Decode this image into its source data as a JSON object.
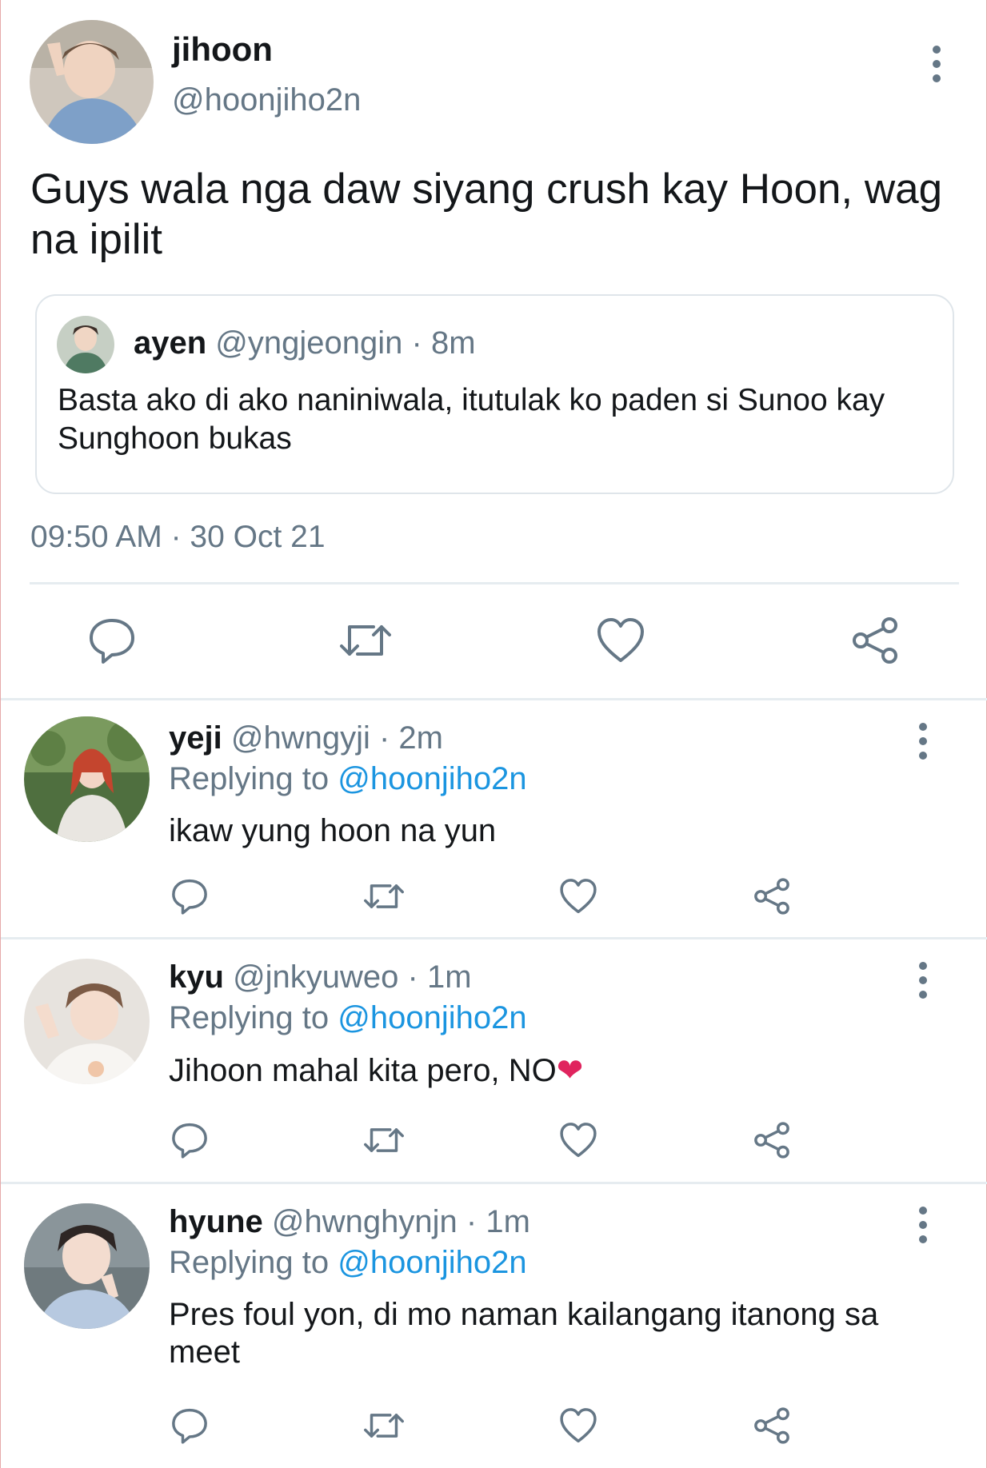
{
  "main_tweet": {
    "name": "jihoon",
    "handle": "@hoonjiho2n",
    "text": "Guys wala nga daw siyang crush kay Hoon, wag na ipilit",
    "quote": {
      "name": "ayen",
      "handle": "@yngjeongin",
      "sep": " · ",
      "time": "8m",
      "text": "Basta ako di ako naniniwala, itutulak ko paden si Sunoo kay Sunghoon bukas"
    },
    "timestamp": "09:50 AM · 30 Oct 21"
  },
  "icons": {
    "reply": "reply-bubble-icon",
    "retweet": "retweet-icon",
    "like": "heart-icon",
    "share": "share-icon",
    "more": "more-vertical-icon"
  },
  "colors": {
    "text": "#14171a",
    "muted": "#657786",
    "link": "#1b95e0",
    "divider": "#e6ecf0"
  },
  "replies": [
    {
      "name": "yeji",
      "handle": "@hwngyji",
      "sep": " · ",
      "time": "2m",
      "replying_prefix": "Replying to ",
      "replying_to": "@hoonjiho2n",
      "text": "ikaw yung hoon na yun",
      "emoji": ""
    },
    {
      "name": "kyu",
      "handle": "@jnkyuweo",
      "sep": " · ",
      "time": "1m",
      "replying_prefix": "Replying to ",
      "replying_to": "@hoonjiho2n",
      "text": "Jihoon mahal kita pero, NO",
      "emoji": "❤"
    },
    {
      "name": "hyune",
      "handle": "@hwnghynjn",
      "sep": " · ",
      "time": "1m",
      "replying_prefix": "Replying to ",
      "replying_to": "@hoonjiho2n",
      "text": "Pres foul yon, di mo naman kailangang itanong sa meet",
      "emoji": ""
    }
  ]
}
